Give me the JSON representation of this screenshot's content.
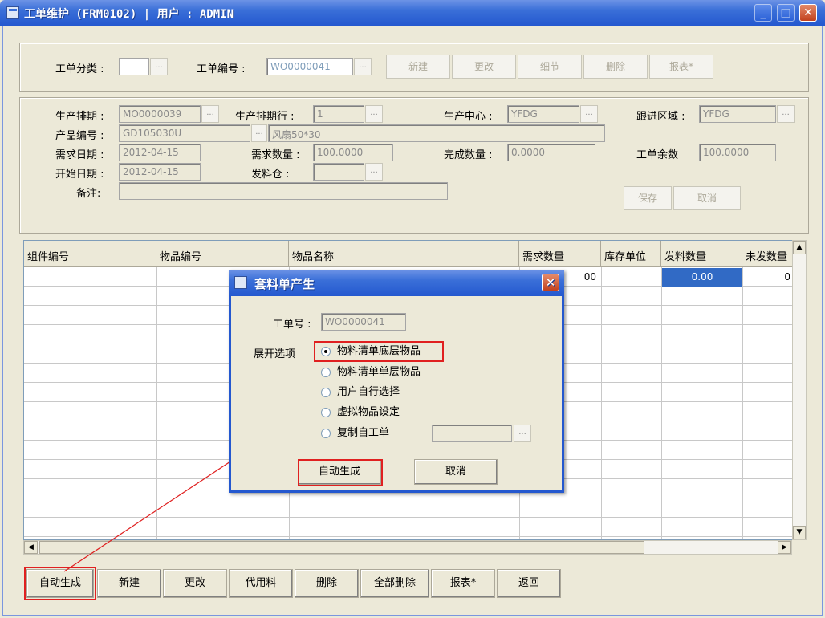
{
  "window": {
    "title": "工单维护 (FRM0102) | 用户 : ADMIN"
  },
  "toolbar": {
    "category_label": "工单分类 :",
    "category_value": "",
    "order_no_label": "工单编号 :",
    "order_no_value": "WO0000041",
    "buttons": [
      "新建",
      "更改",
      "细节",
      "删除",
      "报表*"
    ]
  },
  "form": {
    "schedule_label": "生产排期 :",
    "schedule_value": "MO0000039",
    "schedule_row_label": "生产排期行 :",
    "schedule_row_value": "1",
    "center_label": "生产中心 :",
    "center_value": "YFDG",
    "area_label": "跟进区域 :",
    "area_value": "YFDG",
    "product_label": "产品编号 :",
    "product_value": "GD105030U",
    "product_name": "风扇50*30",
    "req_date_label": "需求日期 :",
    "req_date_value": "2012-04-15",
    "req_qty_label": "需求数量 :",
    "req_qty_value": "100.0000",
    "done_qty_label": "完成数量 :",
    "done_qty_value": "0.0000",
    "remain_label": "工单余数",
    "remain_value": "100.0000",
    "start_date_label": "开始日期 :",
    "start_date_value": "2012-04-15",
    "warehouse_label": "发料仓 :",
    "warehouse_value": "",
    "note_label": "备注:",
    "note_value": "",
    "save_label": "保存",
    "cancel_label": "取消"
  },
  "grid": {
    "columns": [
      "组件编号",
      "物品编号",
      "物品名称",
      "需求数量",
      "库存单位",
      "发料数量",
      "未发数量"
    ],
    "first_row": {
      "req_qty_partial": "00",
      "issued_qty": "0.00",
      "unissued_partial": "0"
    }
  },
  "bottom_buttons": [
    "自动生成",
    "新建",
    "更改",
    "代用料",
    "删除",
    "全部删除",
    "报表*",
    "返回"
  ],
  "dialog": {
    "title": "套料单产生",
    "order_label": "工单号 :",
    "order_value": "WO0000041",
    "expand_label": "展开选项",
    "options": [
      "物料清单底层物品",
      "物料清单单层物品",
      "用户自行选择",
      "虚拟物品设定",
      "复制自工单"
    ],
    "selected_option": 0,
    "auto_label": "自动生成",
    "cancel_label": "取消"
  },
  "colors": {
    "annotation": "#e02020",
    "titlebar": "#2458cf"
  }
}
